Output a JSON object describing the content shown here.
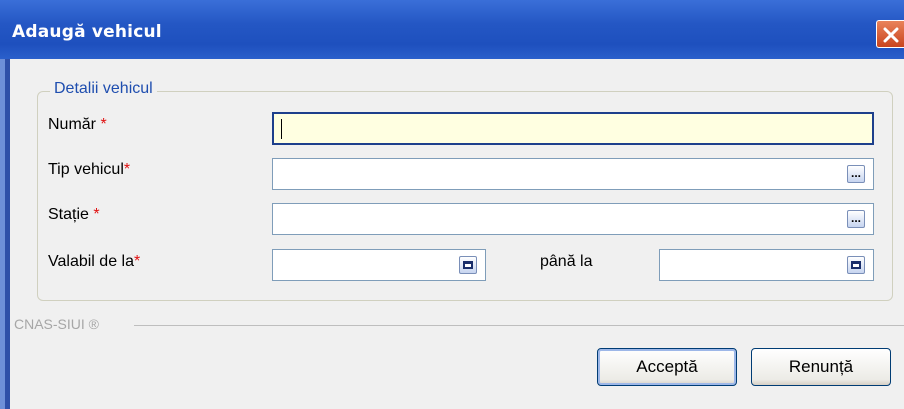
{
  "window": {
    "title": "Adaugă vehicul"
  },
  "fieldset": {
    "legend": "Detalii vehicul"
  },
  "fields": {
    "numar": {
      "label": "Număr",
      "required_mark": "*",
      "value": ""
    },
    "tip_vehicul": {
      "label": "Tip vehicul",
      "required_mark": "*",
      "value": "",
      "button": "..."
    },
    "statie": {
      "label": "Stație",
      "required_mark": "*",
      "value": "",
      "button": "..."
    },
    "valabil_de_la": {
      "label": "Valabil de la",
      "required_mark": "*",
      "value": ""
    },
    "pana_la": {
      "label": "până la",
      "value": ""
    }
  },
  "footer": {
    "brand": "CNAS-SIUI ®"
  },
  "buttons": {
    "accept": "Acceptă",
    "cancel": "Renunță"
  },
  "colors": {
    "titlebar": "#2457C4",
    "legend": "#1F4EAF",
    "required": "#E01010",
    "active_input_bg": "#FFFFE1"
  }
}
